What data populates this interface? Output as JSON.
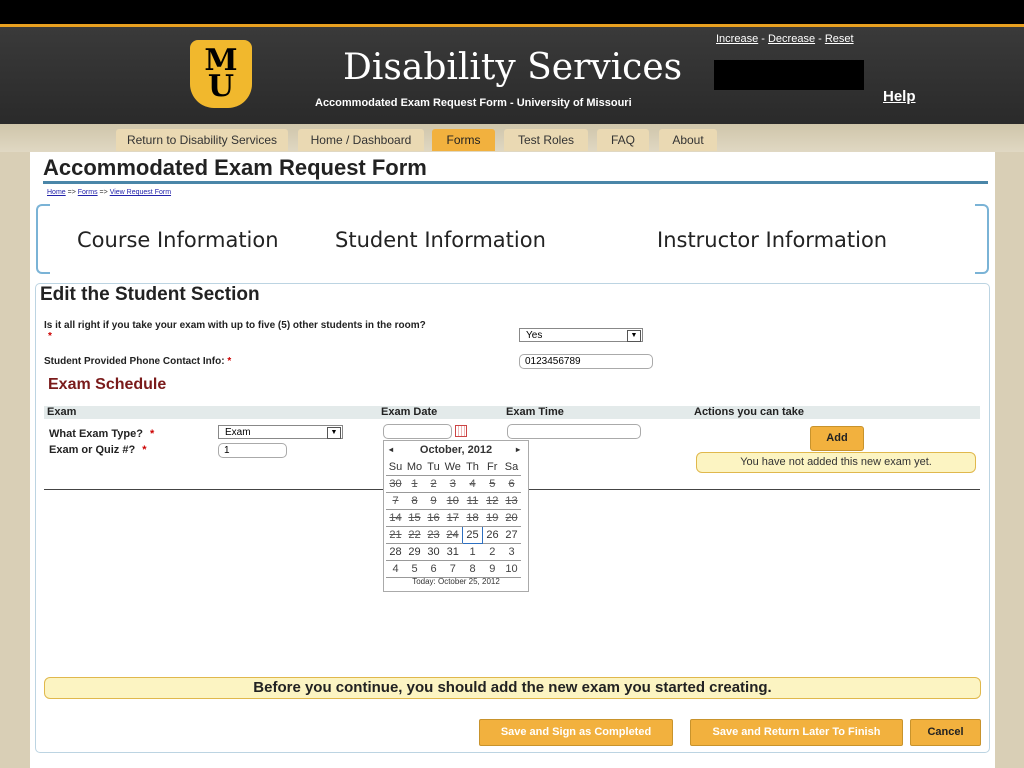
{
  "header": {
    "logo_top": "M",
    "logo_bottom": "U",
    "title": "Disability Services",
    "subtitle": "Accommodated Exam Request Form - University of Missouri",
    "text_size": {
      "increase": "Increase",
      "sep1": " - ",
      "decrease": "Decrease",
      "sep2": " - ",
      "reset": "Reset"
    },
    "help": "Help"
  },
  "nav": {
    "items": [
      {
        "label": "Return to Disability Services"
      },
      {
        "label": "Home / Dashboard"
      },
      {
        "label": "Forms"
      },
      {
        "label": "Test Roles"
      },
      {
        "label": "FAQ"
      },
      {
        "label": "About"
      }
    ],
    "active": "Forms"
  },
  "page": {
    "title": "Accommodated Exam Request Form",
    "breadcrumb": {
      "home": "Home",
      "forms": "Forms",
      "view": "View Request Form",
      "sep": " => "
    },
    "sections": [
      "Course Information",
      "Student Information",
      "Instructor Information"
    ]
  },
  "student_section": {
    "heading": "Edit the Student Section",
    "q_room": "Is it all right if you take your exam with up to five (5) other students in the room?",
    "q_room_value": "Yes",
    "q_phone": "Student Provided Phone Contact Info:",
    "q_phone_value": "0123456789",
    "required_mark": "*"
  },
  "exam_schedule": {
    "heading": "Exam Schedule",
    "columns": [
      "Exam",
      "Exam Date",
      "Exam Time",
      "Actions you can take"
    ],
    "type_label": "What Exam Type?",
    "type_value": "Exam",
    "number_label": "Exam or Quiz #?",
    "number_value": "1",
    "add_label": "Add",
    "not_added_note": "You have not added this new exam yet."
  },
  "calendar": {
    "prev": "◂",
    "next": "▸",
    "month": "October, 2012",
    "dow": [
      "Su",
      "Mo",
      "Tu",
      "We",
      "Th",
      "Fr",
      "Sa"
    ],
    "weeks": [
      [
        "30",
        "1",
        "2",
        "3",
        "4",
        "5",
        "6"
      ],
      [
        "7",
        "8",
        "9",
        "10",
        "11",
        "12",
        "13"
      ],
      [
        "14",
        "15",
        "16",
        "17",
        "18",
        "19",
        "20"
      ],
      [
        "21",
        "22",
        "23",
        "24",
        "25",
        "26",
        "27"
      ],
      [
        "28",
        "29",
        "30",
        "31",
        "1",
        "2",
        "3"
      ],
      [
        "4",
        "5",
        "6",
        "7",
        "8",
        "9",
        "10"
      ]
    ],
    "today_day": "25",
    "today_label": "Today: October 25, 2012"
  },
  "footer": {
    "warning": "Before you continue, you should add the new exam you started creating.",
    "save_completed": "Save and Sign as Completed",
    "save_later": "Save and Return Later To Finish",
    "cancel": "Cancel"
  },
  "colors": {
    "accent": "#f2b13e",
    "rule": "#4a86a8",
    "schedule_heading": "#7a1a1a",
    "note_bg": "#fcf4c2"
  }
}
